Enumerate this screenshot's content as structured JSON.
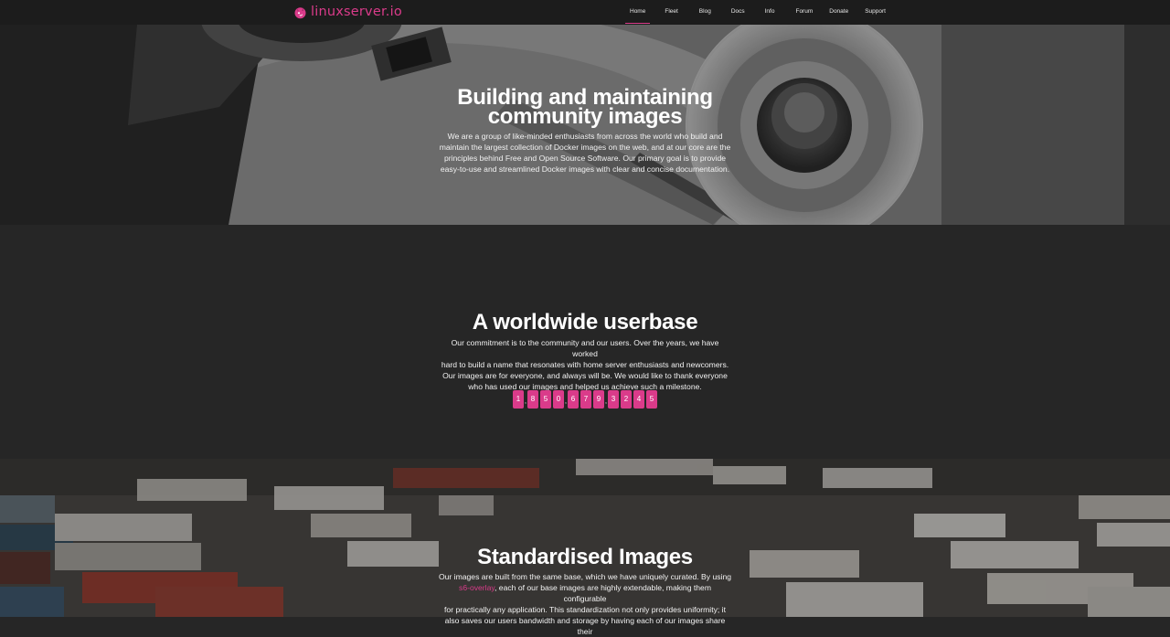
{
  "brand": {
    "name": "linuxserver.io",
    "accent": "#da3b8a"
  },
  "nav": {
    "items": [
      {
        "label": "Home",
        "active": true
      },
      {
        "label": "Fleet"
      },
      {
        "label": "Blog"
      },
      {
        "label": "Docs"
      },
      {
        "label": "Info"
      },
      {
        "label": "Forum"
      },
      {
        "label": "Donate"
      },
      {
        "label": "Support"
      }
    ]
  },
  "hero": {
    "title_line1": "Building and maintaining",
    "title_line2": "community images",
    "body": [
      "We are a group of like-minded enthusiasts from across the world who build and",
      "maintain the largest collection of Docker images on the web, and at our core are the",
      "principles behind Free and Open Source Software. Our primary goal is to provide",
      "easy-to-use and streamlined Docker images with clear and concise documentation."
    ]
  },
  "userbase": {
    "title": "A worldwide userbase",
    "body": [
      "Our commitment is to the community and our users. Over the years, we have worked",
      "hard to build a name that resonates with home server enthusiasts and newcomers.",
      "Our images are for everyone, and always will be. We would like to thank everyone",
      "who has used our images and helped us achieve such a milestone."
    ],
    "counter": {
      "digits": [
        "1",
        "8",
        "5",
        "0",
        "6",
        "7",
        "9",
        "3",
        "2",
        "4",
        "5"
      ],
      "separator": ","
    }
  },
  "standardised": {
    "title": "Standardised Images",
    "line1": "Our images are built from the same base, which we have uniquely curated. By using",
    "link": "s6-overlay",
    "line2_rest": ", each of our base images are highly extendable, making them configurable",
    "line3": "for practically any application. This standardization not only provides uniformity; it",
    "line4": "also saves our users bandwidth and storage by having each of our images share their"
  }
}
